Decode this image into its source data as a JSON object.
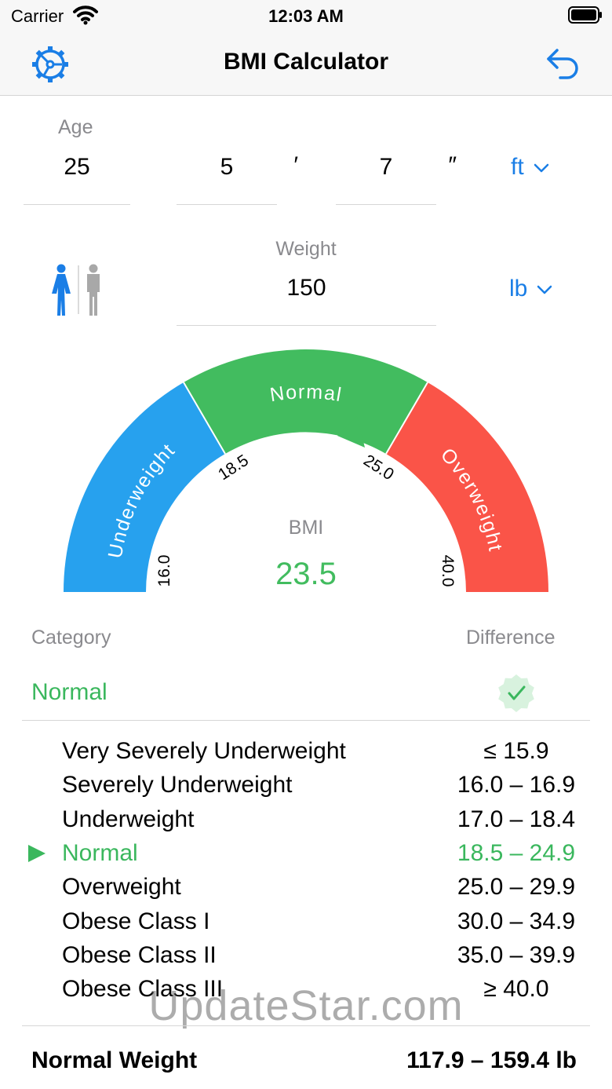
{
  "status_bar": {
    "carrier": "Carrier",
    "time": "12:03 AM"
  },
  "nav": {
    "title": "BMI Calculator",
    "left_icon": "gear-icon",
    "right_icon": "undo-icon"
  },
  "inputs": {
    "age_label": "Age",
    "age_value": "25",
    "height_feet": "5",
    "feet_mark": "′",
    "height_inches": "7",
    "inch_mark": "″",
    "height_unit": "ft",
    "weight_label": "Weight",
    "weight_value": "150",
    "weight_unit": "lb",
    "gender_selected": "female"
  },
  "gauge": {
    "segments": [
      "Underweight",
      "Normal",
      "Overweight"
    ],
    "ticks": [
      "16.0",
      "18.5",
      "25.0",
      "40.0"
    ],
    "bmi_label": "BMI",
    "bmi_value": "23.5",
    "colors": {
      "underweight": "#27a1ee",
      "normal": "#42bc5f",
      "overweight": "#fa5448"
    }
  },
  "table": {
    "category_header": "Category",
    "difference_header": "Difference",
    "current_category": "Normal",
    "rows": [
      {
        "name": "Very Severely Underweight",
        "range": "≤ 15.9"
      },
      {
        "name": "Severely Underweight",
        "range": "16.0 – 16.9"
      },
      {
        "name": "Underweight",
        "range": "17.0 – 18.4"
      },
      {
        "name": "Normal",
        "range": "18.5 – 24.9"
      },
      {
        "name": "Overweight",
        "range": "25.0 – 29.9"
      },
      {
        "name": "Obese Class I",
        "range": "30.0 – 34.9"
      },
      {
        "name": "Obese Class II",
        "range": "35.0 – 39.9"
      },
      {
        "name": "Obese Class III",
        "range": "≥ 40.0"
      }
    ],
    "active_row": 3
  },
  "normal_weight": {
    "label": "Normal Weight",
    "value": "117.9 – 159.4 lb"
  },
  "watermark": "UpdateStar.com"
}
